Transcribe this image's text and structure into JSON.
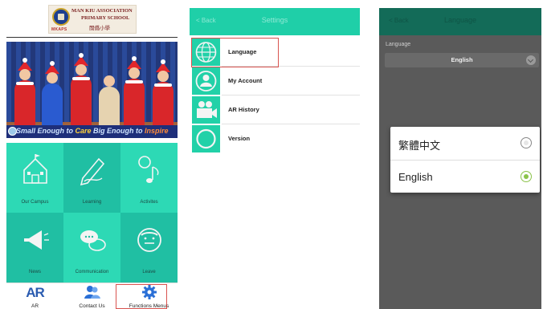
{
  "home": {
    "logo": {
      "name_line1": "MAN KIU ASSOCIATION",
      "name_line2": "PRIMARY SCHOOL",
      "chinese_name": "閩僑小學",
      "crest_text": "MKAPS"
    },
    "banner": {
      "slogan_prefix": "Small Enough to ",
      "slogan_word1": "Care",
      "slogan_mid": " Big Enough to ",
      "slogan_word2": "Inspire"
    },
    "tiles": [
      {
        "label": "Our Campus",
        "icon": "school-building-icon"
      },
      {
        "label": "Learning",
        "icon": "pencil-icon"
      },
      {
        "label": "Activites",
        "icon": "music-note-icon"
      },
      {
        "label": "News",
        "icon": "megaphone-icon"
      },
      {
        "label": "Communication",
        "icon": "chat-bubbles-icon"
      },
      {
        "label": "Leave",
        "icon": "sick-face-icon"
      }
    ],
    "bottom_nav": [
      {
        "label": "AR",
        "icon": "ar-text-icon",
        "icon_text": "AR"
      },
      {
        "label": "Contact Us",
        "icon": "contacts-icon"
      },
      {
        "label": "Functions Menus",
        "icon": "gear-icon"
      }
    ]
  },
  "settings": {
    "topbar": {
      "back": "< Back",
      "title": "Settings"
    },
    "items": [
      {
        "label": "Language",
        "icon": "globe-icon"
      },
      {
        "label": "My Account",
        "icon": "user-icon"
      },
      {
        "label": "AR History",
        "icon": "video-camera-icon"
      },
      {
        "label": "Version",
        "icon": "circle-icon"
      }
    ]
  },
  "language": {
    "topbar": {
      "back": "< Back",
      "title": "Language"
    },
    "field_label": "Language",
    "selected_value": "English",
    "options": [
      {
        "label": "繁體中文",
        "selected": false
      },
      {
        "label": "English",
        "selected": true
      }
    ]
  },
  "colors": {
    "accent_teal": "#20bfa3",
    "highlight_red": "#d9534f",
    "radio_green": "#8bc34a"
  }
}
